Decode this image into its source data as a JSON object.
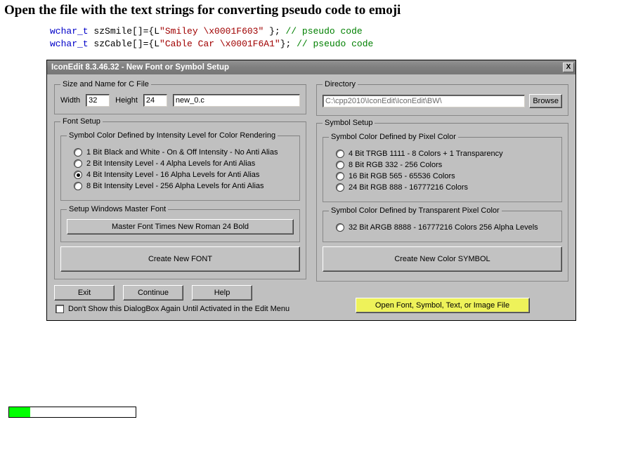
{
  "page": {
    "title": "Open the file with the text strings for converting pseudo code to emoji"
  },
  "code": {
    "line1": {
      "prefix": "wchar_t szSmile[]={L",
      "literal": "\"Smiley \\x0001F603\" ",
      "suffix": "}; ",
      "comment": "// pseudo code"
    },
    "line2": {
      "prefix": "wchar_t szCable[]={L",
      "literal": "\"Cable Car \\x0001F6A1\"",
      "suffix": "}; ",
      "comment": "// pseudo code"
    }
  },
  "dialog": {
    "title": "IconEdit 8.3.46.32 - New Font or Symbol Setup",
    "close_x": "X",
    "size_and_name": {
      "legend": "Size and Name for C File",
      "width_label": "Width",
      "width_value": "32",
      "height_label": "Height",
      "height_value": "24",
      "filename": "new_0.c"
    },
    "directory": {
      "legend": "Directory",
      "path": "C:\\cpp2010\\IconEdit\\IconEdit\\BW\\",
      "browse": "Browse"
    },
    "font_setup": {
      "legend": "Font Setup",
      "intensity_legend": "Symbol Color Defined by Intensity Level for Color Rendering",
      "options": {
        "0": "1 Bit Black and White - On & Off Intensity - No Anti Alias",
        "1": "2 Bit Intensity Level - 4 Alpha Levels for Anti Alias",
        "2": "4 Bit Intensity Level - 16 Alpha Levels for Anti Alias",
        "3": "8 Bit Intensity Level - 256 Alpha Levels for Anti Alias"
      },
      "master_legend": "Setup Windows Master Font",
      "master_btn": "Master Font  Times New Roman 24 Bold",
      "create_btn": "Create New FONT"
    },
    "symbol_setup": {
      "legend": "Symbol Setup",
      "pixel_legend": "Symbol Color Defined by Pixel Color",
      "pixel_options": {
        "0": "4 Bit TRGB 1111 - 8 Colors + 1 Transparency",
        "1": "8 Bit RGB 332 - 256 Colors",
        "2": "16 Bit RGB 565 - 65536 Colors",
        "3": "24 Bit RGB 888 - 16777216 Colors"
      },
      "transp_legend": "Symbol Color Defined by Transparent Pixel Color",
      "transp_options": {
        "0": "32 Bit ARGB 8888 - 16777216 Colors 256 Alpha Levels"
      },
      "create_btn": "Create New Color SYMBOL"
    },
    "footer": {
      "exit": "Exit",
      "continue": "Continue",
      "help": "Help",
      "dont_show": "Don't Show this DialogBox Again Until Activated in the Edit Menu",
      "open_file": "Open Font, Symbol, Text, or Image File"
    }
  }
}
